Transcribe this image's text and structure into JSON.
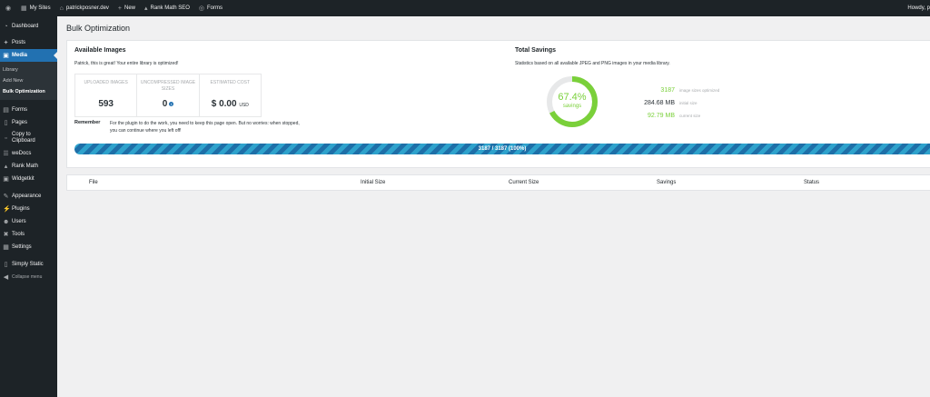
{
  "admin_bar": {
    "wp_icon": "wordpress-icon",
    "my_sites": "My Sites",
    "site_name": "patrickposner.dev",
    "new_label": "New",
    "rank_math": "Rank Math SEO",
    "forms": "Forms",
    "howdy": "Howdy, p"
  },
  "sidebar": {
    "items": [
      {
        "label": "Dashboard",
        "icon": "dashboard-icon"
      },
      {
        "label": "Posts",
        "icon": "pin-icon"
      },
      {
        "label": "Media",
        "icon": "media-icon"
      },
      {
        "label": "Forms",
        "icon": "forms-icon"
      },
      {
        "label": "Pages",
        "icon": "pages-icon"
      },
      {
        "label": "Copy to Clipboard",
        "icon": "clipboard-icon"
      },
      {
        "label": "weDocs",
        "icon": "docs-icon"
      },
      {
        "label": "Rank Math",
        "icon": "chart-icon"
      },
      {
        "label": "Widgetkit",
        "icon": "widget-icon"
      },
      {
        "label": "Appearance",
        "icon": "brush-icon"
      },
      {
        "label": "Plugins",
        "icon": "plug-icon"
      },
      {
        "label": "Users",
        "icon": "users-icon"
      },
      {
        "label": "Tools",
        "icon": "wrench-icon"
      },
      {
        "label": "Settings",
        "icon": "settings-icon"
      },
      {
        "label": "Simply Static",
        "icon": "file-icon"
      },
      {
        "label": "Collapse menu",
        "icon": "collapse-icon"
      }
    ],
    "media_submenu": [
      "Library",
      "Add New",
      "Bulk Optimization"
    ]
  },
  "page": {
    "title": "Bulk Optimization"
  },
  "available_images": {
    "heading": "Available Images",
    "message": "Patrick, this is great! Your entire library is optimized!",
    "stats": [
      {
        "label": "UPLOADED IMAGES",
        "value": "593"
      },
      {
        "label": "UNCOMPRESSED IMAGE SIZES",
        "value": "0"
      },
      {
        "label": "ESTIMATED COST",
        "value": "$ 0.00",
        "unit": "USD"
      }
    ],
    "remember_label": "Remember",
    "remember_text": "For the plugin to do the work, you need to keep this page open. But no worries: when stopped, you can continue where you left off!"
  },
  "total_savings": {
    "heading": "Total Savings",
    "description": "Statistics based on all available JPEG and PNG images in your media library.",
    "percent": "67.4%",
    "percent_value": 67.4,
    "percent_label": "savings",
    "rows": [
      {
        "value": "3187",
        "label": "image sizes optimized"
      },
      {
        "value": "284.68 MB",
        "label": "initial size"
      },
      {
        "value": "92.79 MB",
        "label": "current size"
      }
    ]
  },
  "progress": {
    "text": "3187 / 3187 (100%)",
    "fraction": 1.0
  },
  "table": {
    "columns": [
      "File",
      "Initial Size",
      "Current Size",
      "Savings",
      "Status"
    ]
  },
  "colors": {
    "admin_bg": "#1d2327",
    "accent": "#2271b1",
    "green": "#7ad03a",
    "progress": "#2ea2cc"
  }
}
